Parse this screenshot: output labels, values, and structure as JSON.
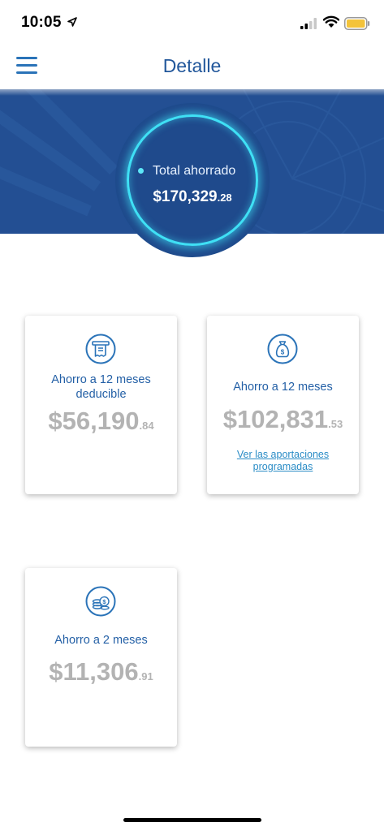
{
  "status_bar": {
    "time": "10:05"
  },
  "header": {
    "title": "Detalle"
  },
  "summary": {
    "label": "Total ahorrado",
    "amount_main": "$170,329",
    "amount_cents": ".28"
  },
  "cards": [
    {
      "label": "Ahorro a 12 meses deducible",
      "amount_main": "$56,190",
      "amount_cents": ".84",
      "icon": "receipt-icon"
    },
    {
      "label": "Ahorro a 12 meses",
      "amount_main": "$102,831",
      "amount_cents": ".53",
      "icon": "money-bag-icon",
      "link": "Ver las aportaciones programadas"
    },
    {
      "label": "Ahorro a 2 meses",
      "amount_main": "$11,306",
      "amount_cents": ".91",
      "icon": "coins-icon"
    }
  ],
  "colors": {
    "primary": "#234f93",
    "accent": "#3fe0f5",
    "label": "#2460a6",
    "amount": "#b3b3b3",
    "link": "#2a8cc6"
  }
}
